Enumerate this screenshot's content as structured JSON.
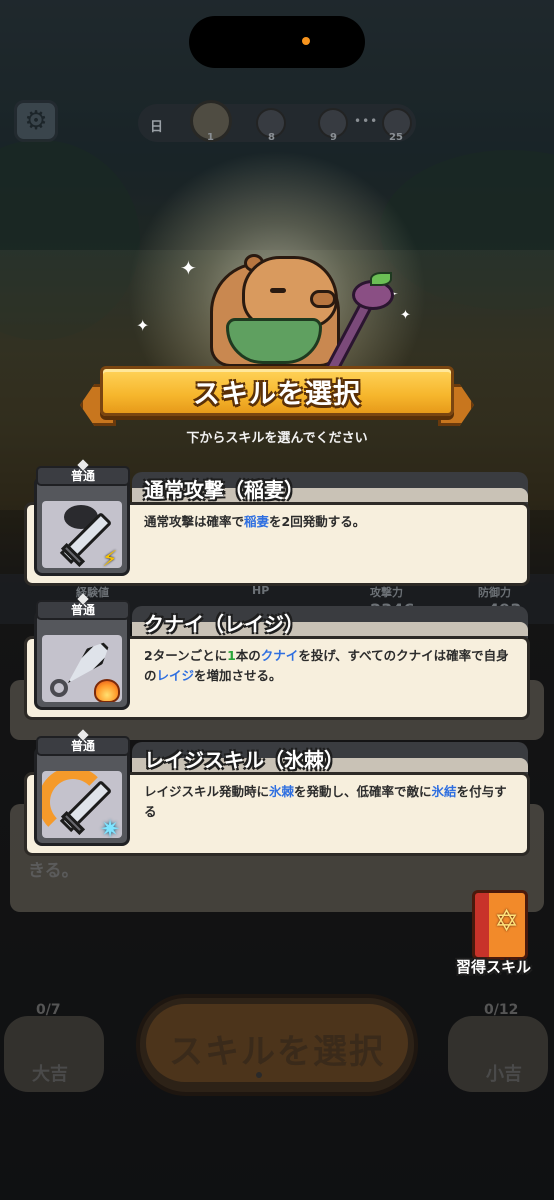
{
  "top_bar": {
    "day_label": "日",
    "nodes": [
      {
        "name": "stage-1",
        "number": "1"
      },
      {
        "name": "stage-8",
        "number": "8"
      },
      {
        "name": "stage-9",
        "number": "9"
      },
      {
        "name": "stage-25",
        "number": "25"
      }
    ],
    "dots": "•••"
  },
  "background_stats": {
    "exp_label": "経験値",
    "hp_label": "HP",
    "attack_label": "攻撃力",
    "attack_value": "2346",
    "defense_label": "防御力",
    "defense_value": "493",
    "obscured_text": "きる。"
  },
  "dialog": {
    "title": "スキルを選択",
    "subtitle": "下からスキルを選んでください"
  },
  "skills": [
    {
      "rarity": "普通",
      "name": "通常攻撃（稲妻）",
      "icon": "sword-lightning-icon",
      "desc": [
        {
          "t": "通常攻撃は確率で",
          "c": ""
        },
        {
          "t": "稲妻",
          "c": "blue"
        },
        {
          "t": "を2回発動する。",
          "c": ""
        }
      ]
    },
    {
      "rarity": "普通",
      "name": "クナイ（レイジ）",
      "icon": "kunai-fire-icon",
      "desc": [
        {
          "t": "2ターンごとに",
          "c": ""
        },
        {
          "t": "1",
          "c": "green"
        },
        {
          "t": "本の",
          "c": ""
        },
        {
          "t": "クナイ",
          "c": "blue"
        },
        {
          "t": "を投げ、すべてのクナイは確率で自身の",
          "c": ""
        },
        {
          "t": "レイジ",
          "c": "blue"
        },
        {
          "t": "を増加させる。",
          "c": ""
        }
      ]
    },
    {
      "rarity": "普通",
      "name": "レイジスキル（氷棘）",
      "icon": "sword-ice-icon",
      "desc": [
        {
          "t": "レイジスキル発動時に",
          "c": ""
        },
        {
          "t": "氷棘",
          "c": "blue"
        },
        {
          "t": "を発動し、低確率で敵に",
          "c": ""
        },
        {
          "t": "氷結",
          "c": "blue"
        },
        {
          "t": "を付与する",
          "c": ""
        }
      ]
    }
  ],
  "learned_skills": {
    "label": "習得スキル",
    "icon": "spellbook-icon"
  },
  "bottom_hud": {
    "left_count": "0/7",
    "left_label": "大吉",
    "main_label": "スキルを選択",
    "right_count": "0/12",
    "right_label": "小吉"
  },
  "colors": {
    "highlight_blue": "#2f6fe0",
    "highlight_green": "#2aa53a",
    "banner_gold": "#f6b62c",
    "card_bg": "#f7efdd"
  }
}
